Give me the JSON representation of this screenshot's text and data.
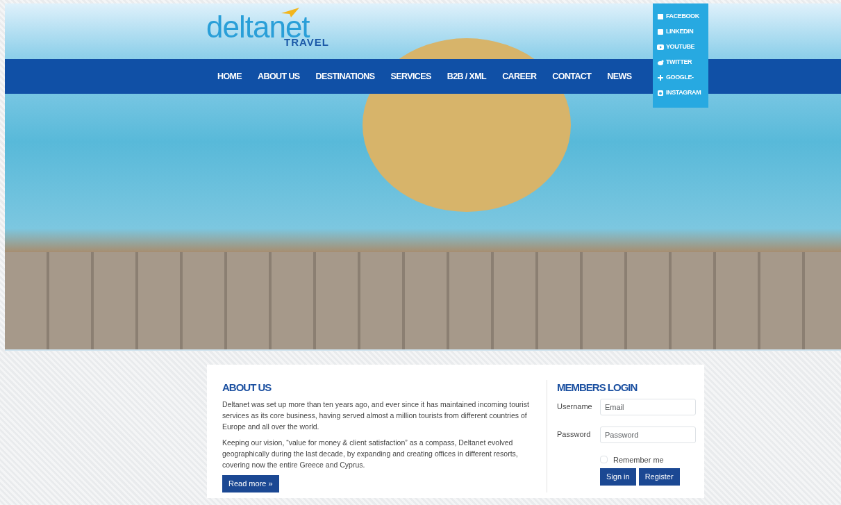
{
  "logo": {
    "name": "deltanet",
    "tagline": "TRAVEL"
  },
  "nav": [
    {
      "label": "HOME"
    },
    {
      "label": "ABOUT US"
    },
    {
      "label": "DESTINATIONS"
    },
    {
      "label": "SERVICES"
    },
    {
      "label": "B2B / XML"
    },
    {
      "label": "CAREER"
    },
    {
      "label": "CONTACT"
    },
    {
      "label": "NEWS"
    }
  ],
  "social": [
    {
      "kind": "facebook",
      "label": "FACEBOOK"
    },
    {
      "kind": "linkedin",
      "label": "LINKEDIN"
    },
    {
      "kind": "youtube",
      "label": "YOUTUBE"
    },
    {
      "kind": "twitter",
      "label": "TWITTER"
    },
    {
      "kind": "google",
      "label": "GOOGLE-"
    },
    {
      "kind": "instagram",
      "label": "INSTAGRAM"
    }
  ],
  "about": {
    "title": "ABOUT US",
    "paragraphs": [
      "Deltanet was set up more than ten years ago, and ever since it has maintained incoming tourist services as its core business, having served almost a million tourists from different countries of Europe and all over the world.",
      "Keeping our vision, “value for money & client satisfaction” as a compass, Deltanet evolved geographically during the last decade, by expanding and creating offices in different resorts, covering now the entire Greece and Cyprus."
    ],
    "button": "Read more »"
  },
  "login": {
    "title": "MEMBERS LOGIN",
    "fields": [
      {
        "label": "Username",
        "placeholder": "Email"
      },
      {
        "label": "Password",
        "placeholder": "Password"
      }
    ],
    "remember": {
      "label": "Remember me",
      "checked": false
    },
    "buttons": [
      "Sign in",
      "Register"
    ]
  }
}
